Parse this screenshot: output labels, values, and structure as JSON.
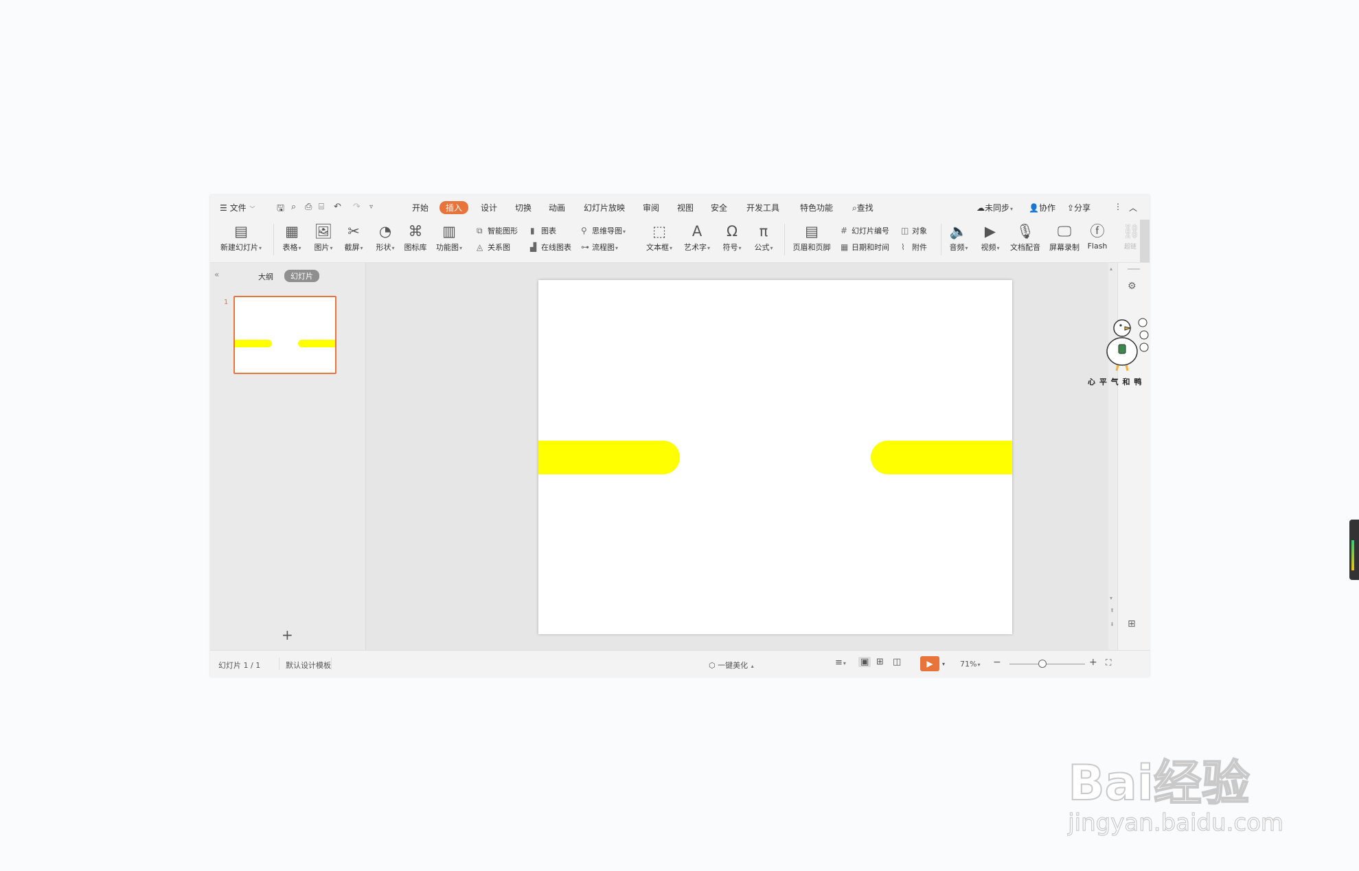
{
  "menu": {
    "file": "文件",
    "tabs": [
      "开始",
      "插入",
      "设计",
      "切换",
      "动画",
      "幻灯片放映",
      "审阅",
      "视图",
      "安全",
      "开发工具",
      "特色功能"
    ],
    "active_tab": "插入",
    "search": "查找",
    "sync": "未同步",
    "collab": "协作",
    "share": "分享"
  },
  "ribbon": {
    "new_slide": "新建幻灯片",
    "table": "表格",
    "picture": "图片",
    "screenshot": "截屏",
    "shape": "形状",
    "icon_lib": "图标库",
    "func_chart": "功能图",
    "smart_art": "智能图形",
    "chart": "图表",
    "relation": "关系图",
    "online_chart": "在线图表",
    "mindmap": "思维导图",
    "flowchart": "流程图",
    "textbox": "文本框",
    "wordart": "艺术字",
    "symbol": "符号",
    "formula": "公式",
    "header_footer": "页眉和页脚",
    "slide_number": "幻灯片编号",
    "object": "对象",
    "datetime": "日期和时间",
    "attachment": "附件",
    "audio": "音频",
    "video": "视频",
    "doc_voice": "文档配音",
    "screen_rec": "屏幕录制",
    "flash": "Flash",
    "hyperlink": "超链"
  },
  "panel": {
    "outline_tab": "大纲",
    "slides_tab": "幻灯片",
    "slide_index": "1",
    "add": "+"
  },
  "status": {
    "slide_counter": "幻灯片 1 / 1",
    "template": "默认设计模板",
    "beautify": "一键美化",
    "zoom": "71%"
  },
  "sticker": {
    "caption": "心 平 气 和 鸭"
  },
  "watermark": {
    "brand": "Bai经验",
    "url": "jingyan.baidu.com"
  },
  "colors": {
    "accent": "#e8743b",
    "shape_fill": "#ffff00"
  }
}
